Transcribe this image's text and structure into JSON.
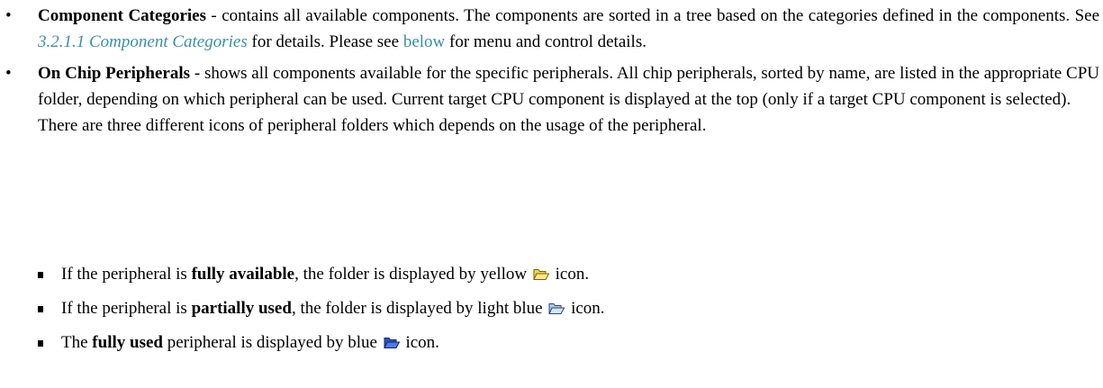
{
  "component_categories": {
    "title": "Component Categories",
    "text1": " - contains all available components. The components are sorted in a tree based on the categories defined in the components. See ",
    "xref": "3.2.1.1 Component Categories",
    "text2": " for details. Please see ",
    "link": "below",
    "text3": " for menu and control details."
  },
  "on_chip": {
    "title": "On Chip Peripherals",
    "text": " - shows all components available for the specific peripherals. All chip peripherals, sorted by name, are listed in the appropriate CPU folder, depending on which peripheral can be used. Current target CPU component is displayed at the top (only if a target CPU component is selected).",
    "note": "There are three different icons of peripheral folders which depends on the usage of the peripheral."
  },
  "sub_items": [
    {
      "prefix": "If the peripheral is ",
      "bold": "fully available",
      "mid": ", the folder is displayed by yellow ",
      "suffix": " icon.",
      "icon": "folder-open-yellow-icon",
      "color": "#f2d34a"
    },
    {
      "prefix": "If the peripheral is ",
      "bold": "partially used",
      "mid": ", the folder is displayed by light blue ",
      "suffix": " icon.",
      "icon": "folder-open-light-blue-icon",
      "color": "#a9cbe8"
    },
    {
      "prefix": "The ",
      "bold": "fully used",
      "mid": " peripheral is displayed by blue ",
      "suffix": " icon.",
      "icon": "folder-open-blue-icon",
      "color": "#2a56c6"
    }
  ]
}
